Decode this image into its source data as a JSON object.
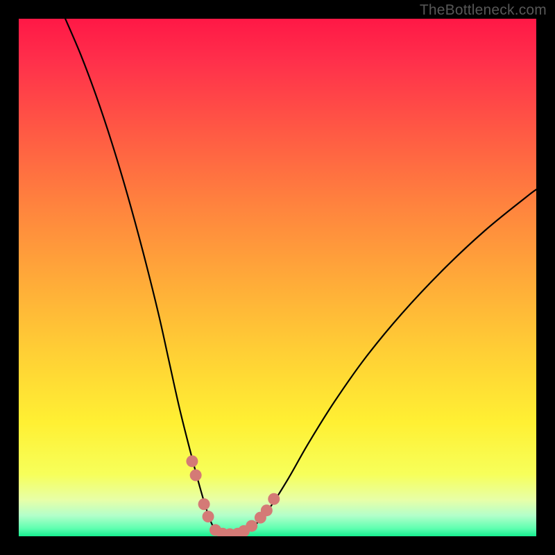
{
  "watermark": "TheBottleneck.com",
  "chart_data": {
    "type": "line",
    "title": "",
    "xlabel": "",
    "ylabel": "",
    "xlim": [
      0,
      100
    ],
    "ylim": [
      0,
      100
    ],
    "grid": false,
    "legend": false,
    "curve": {
      "x": [
        9.0,
        12.0,
        15.0,
        18.0,
        21.0,
        24.0,
        27.0,
        29.0,
        31.0,
        33.0,
        35.0,
        36.5,
        37.5,
        38.5,
        40.0,
        42.0,
        44.0,
        46.0,
        48.5,
        52.0,
        56.0,
        61.0,
        67.0,
        74.0,
        82.0,
        90.0,
        98.0,
        100.0
      ],
      "y": [
        100.0,
        93.0,
        85.0,
        76.0,
        66.0,
        55.0,
        43.0,
        34.0,
        25.0,
        17.0,
        9.5,
        4.5,
        2.0,
        0.8,
        0.3,
        0.3,
        1.0,
        2.5,
        5.5,
        11.0,
        18.0,
        26.0,
        34.5,
        43.0,
        51.5,
        59.0,
        65.5,
        67.0
      ]
    },
    "markers": [
      {
        "x": 33.5,
        "y": 14.5
      },
      {
        "x": 34.2,
        "y": 11.8
      },
      {
        "x": 35.8,
        "y": 6.2
      },
      {
        "x": 36.6,
        "y": 3.8
      },
      {
        "x": 38.0,
        "y": 1.2
      },
      {
        "x": 39.4,
        "y": 0.5
      },
      {
        "x": 40.8,
        "y": 0.4
      },
      {
        "x": 42.3,
        "y": 0.5
      },
      {
        "x": 43.5,
        "y": 1.0
      },
      {
        "x": 45.0,
        "y": 2.0
      },
      {
        "x": 46.7,
        "y": 3.6
      },
      {
        "x": 47.9,
        "y": 5.0
      },
      {
        "x": 49.3,
        "y": 7.2
      }
    ],
    "colors": {
      "top": "#ff1846",
      "mid": "#ffce35",
      "bottom": "#16ee90",
      "frame": "#000000",
      "curve": "#000000",
      "marker": "#d47a76"
    }
  }
}
